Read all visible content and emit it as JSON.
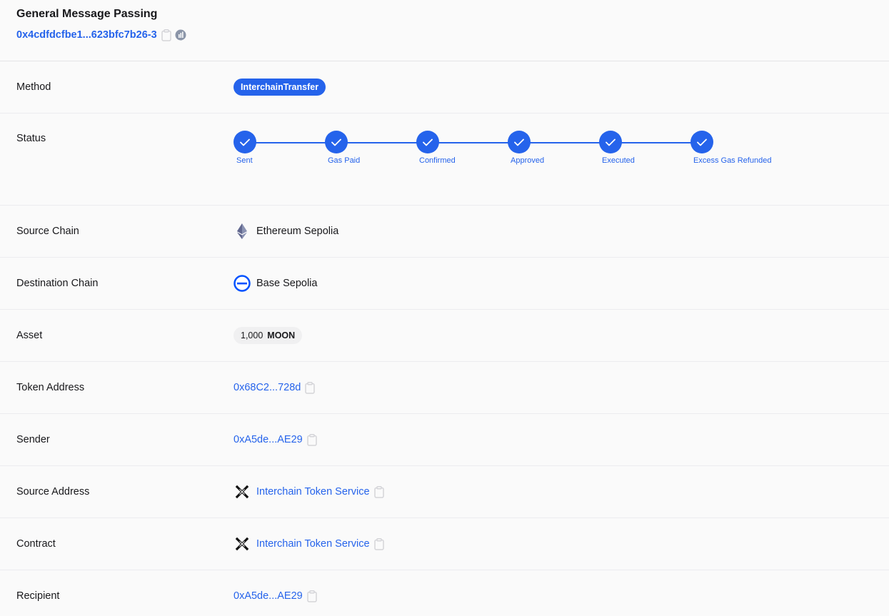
{
  "header": {
    "title": "General Message Passing",
    "tx_id": "0x4cdfdcfbe1...623bfc7b26-3"
  },
  "rows": {
    "method": {
      "label": "Method",
      "value": "InterchainTransfer"
    },
    "status": {
      "label": "Status",
      "steps": [
        "Sent",
        "Gas Paid",
        "Confirmed",
        "Approved",
        "Executed",
        "Excess Gas Refunded"
      ]
    },
    "source_chain": {
      "label": "Source Chain",
      "value": "Ethereum Sepolia",
      "icon": "ethereum-icon"
    },
    "destination_chain": {
      "label": "Destination Chain",
      "value": "Base Sepolia",
      "icon": "base-icon"
    },
    "asset": {
      "label": "Asset",
      "amount": "1,000",
      "symbol": "MOON"
    },
    "token_address": {
      "label": "Token Address",
      "value": "0x68C2...728d"
    },
    "sender": {
      "label": "Sender",
      "value": "0xA5de...AE29"
    },
    "source_address": {
      "label": "Source Address",
      "value": "Interchain Token Service",
      "icon": "axelar-icon"
    },
    "contract": {
      "label": "Contract",
      "value": "Interchain Token Service",
      "icon": "axelar-icon"
    },
    "recipient": {
      "label": "Recipient",
      "value": "0xA5de...AE29"
    }
  },
  "colors": {
    "accent": "#2563eb",
    "background": "#fafafa",
    "text": "#18181b"
  }
}
